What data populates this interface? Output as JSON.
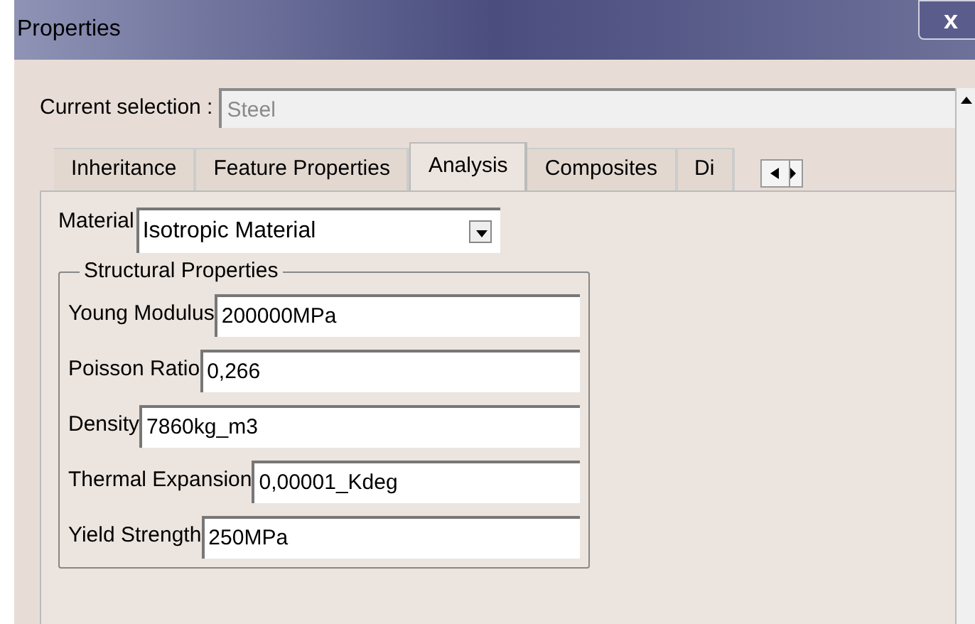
{
  "window": {
    "title": "Properties",
    "close": "x"
  },
  "current_selection": {
    "label": "Current selection :",
    "value": "Steel"
  },
  "tabs": [
    {
      "label": "Inheritance",
      "selected": false
    },
    {
      "label": "Feature Properties",
      "selected": false
    },
    {
      "label": "Analysis",
      "selected": true
    },
    {
      "label": "Composites",
      "selected": false
    },
    {
      "label": "Di",
      "selected": false
    }
  ],
  "material": {
    "label": "Material",
    "value": "Isotropic Material"
  },
  "structural_properties": {
    "title": "Structural Properties",
    "fields": [
      {
        "label": "Young Modulus",
        "value": "200000MPa"
      },
      {
        "label": "Poisson Ratio",
        "value": "0,266"
      },
      {
        "label": "Density",
        "value": "7860kg_m3"
      },
      {
        "label": "Thermal Expansion",
        "value": "0,00001_Kdeg"
      },
      {
        "label": "Yield Strength",
        "value": "250MPa"
      }
    ]
  }
}
